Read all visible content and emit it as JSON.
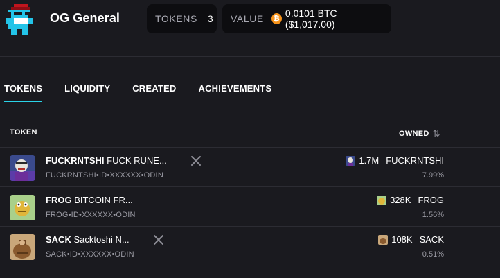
{
  "profile": {
    "name": "OG General"
  },
  "stats": {
    "tokens_label": "TOKENS",
    "tokens_count": "3",
    "value_label": "VALUE",
    "value_text": "0.0101 BTC ($1,017.00)",
    "btc_glyph": "₿"
  },
  "tabs": [
    {
      "label": "TOKENS",
      "active": true
    },
    {
      "label": "LIQUIDITY",
      "active": false
    },
    {
      "label": "CREATED",
      "active": false
    },
    {
      "label": "ACHIEVEMENTS",
      "active": false
    }
  ],
  "table": {
    "col_token": "TOKEN",
    "col_owned": "OWNED",
    "sort_glyph": "⇅",
    "rows": [
      {
        "ticker": "FUCKRNTSHI",
        "name": "FUCK RUNE...",
        "id_line": "FUCKRNTSHI•ID•XXXXXX•ODIN",
        "has_x_link": true,
        "amount": "1.7M",
        "owned_ticker": "FUCKRNTSHI",
        "percent": "7.99%"
      },
      {
        "ticker": "FROG",
        "name": "BITCOIN FR...",
        "id_line": "FROG•ID•XXXXXX•ODIN",
        "has_x_link": false,
        "amount": "328K",
        "owned_ticker": "FROG",
        "percent": "1.56%"
      },
      {
        "ticker": "SACK",
        "name": "Sacktoshi N...",
        "id_line": "SACK•ID•XXXXXX•ODIN",
        "has_x_link": true,
        "amount": "108K",
        "owned_ticker": "SACK",
        "percent": "0.51%"
      }
    ]
  },
  "colors": {
    "background": "#1a1a1f",
    "accent": "#2ad3e8",
    "btc": "#f7931a"
  },
  "icons": [
    "pixel-avatar-icon",
    "btc-icon",
    "x-logo-icon",
    "sort-icon",
    "token-image-fuckrntshi",
    "token-image-frog",
    "token-image-sack"
  ]
}
